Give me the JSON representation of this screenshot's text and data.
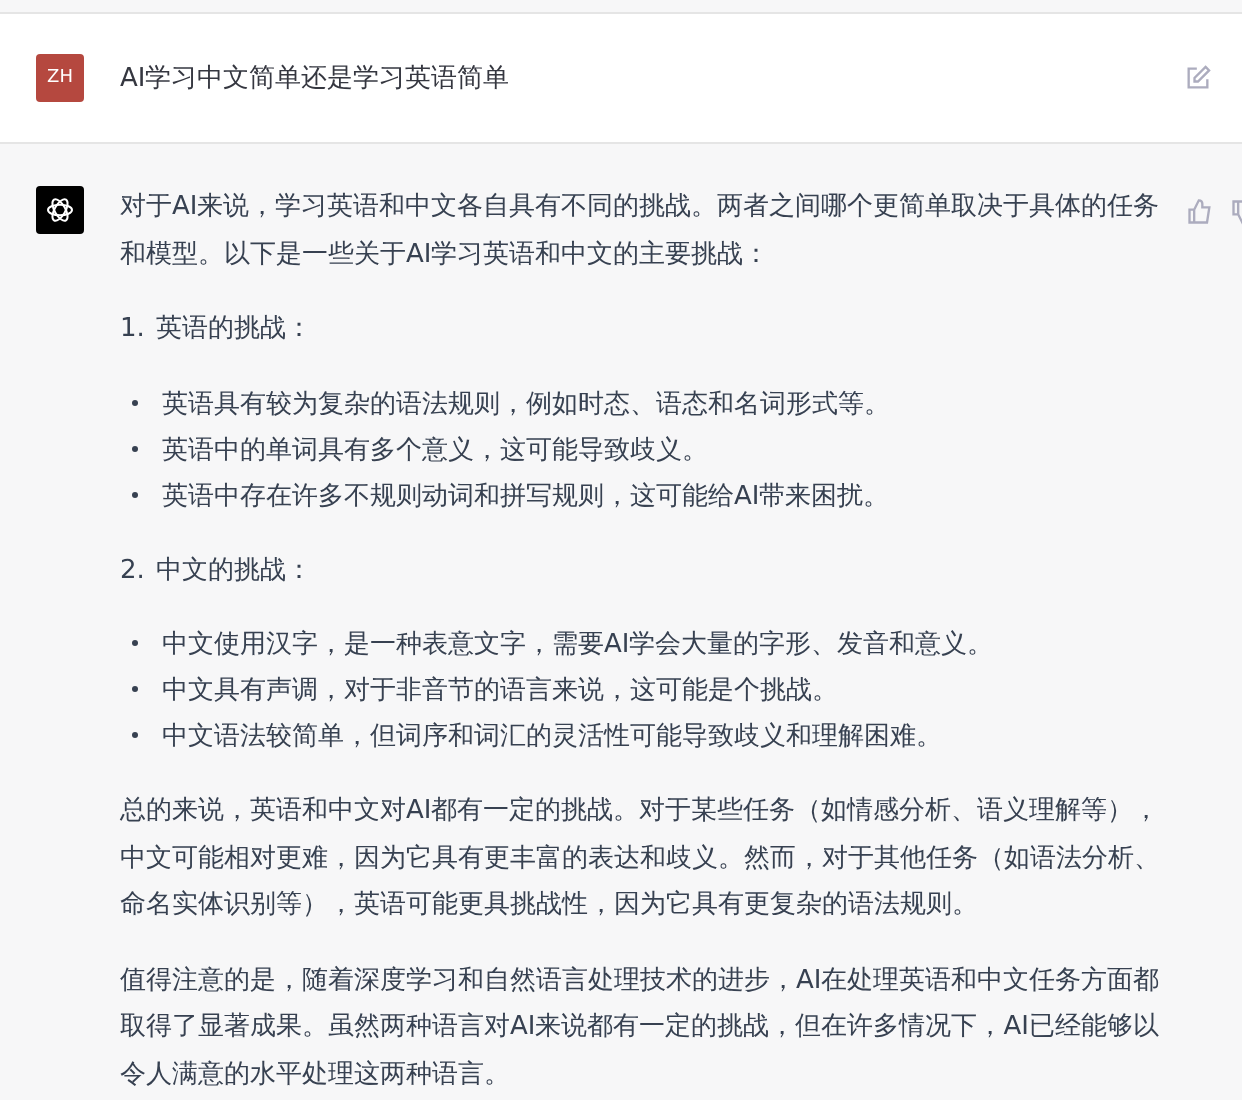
{
  "user_message": {
    "avatar": "ZH",
    "text": "AI学习中文简单还是学习英语简单"
  },
  "assistant_message": {
    "blocks": [
      {
        "kind": "paragraph",
        "text": "对于AI来说，学习英语和中文各自具有不同的挑战。两者之间哪个更简单取决于具体的任务和模型。以下是一些关于AI学习英语和中文的主要挑战："
      },
      {
        "kind": "heading",
        "number": "1.",
        "text": "英语的挑战："
      },
      {
        "kind": "bullets",
        "items": [
          "英语具有较为复杂的语法规则，例如时态、语态和名词形式等。",
          "英语中的单词具有多个意义，这可能导致歧义。",
          "英语中存在许多不规则动词和拼写规则，这可能给AI带来困扰。"
        ]
      },
      {
        "kind": "heading",
        "number": "2.",
        "text": "中文的挑战："
      },
      {
        "kind": "bullets",
        "items": [
          "中文使用汉字，是一种表意文字，需要AI学会大量的字形、发音和意义。",
          "中文具有声调，对于非音节的语言来说，这可能是个挑战。",
          "中文语法较简单，但词序和词汇的灵活性可能导致歧义和理解困难。"
        ]
      },
      {
        "kind": "paragraph",
        "text": "总的来说，英语和中文对AI都有一定的挑战。对于某些任务（如情感分析、语义理解等），中文可能相对更难，因为它具有更丰富的表达和歧义。然而，对于其他任务（如语法分析、命名实体识别等），英语可能更具挑战性，因为它具有更复杂的语法规则。"
      },
      {
        "kind": "paragraph",
        "text": "值得注意的是，随着深度学习和自然语言处理技术的进步，AI在处理英语和中文任务方面都取得了显著成果。虽然两种语言对AI来说都有一定的挑战，但在许多情况下，AI已经能够以令人满意的水平处理这两种语言。"
      }
    ]
  }
}
